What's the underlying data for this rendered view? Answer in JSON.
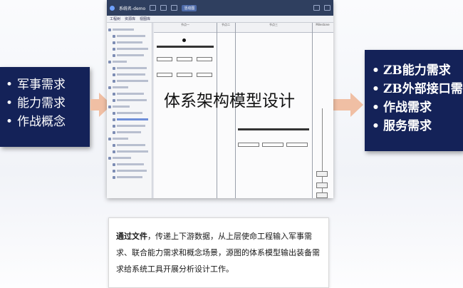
{
  "left_box": {
    "items": [
      "军事需求",
      "能力需求",
      "作战概念"
    ]
  },
  "right_box": {
    "items": [
      "ZB能力需求",
      "ZB外部接口需求",
      "作战需求",
      "服务需求"
    ]
  },
  "tool_window": {
    "title": "系统名-demo",
    "menus": [
      "工程树",
      "资源库",
      "视图库"
    ],
    "toolbar_chip": "活动图",
    "lanes": [
      "节点一",
      "节点二",
      "节点三",
      "Milestone"
    ]
  },
  "overlay_title": "体系架构模型设计",
  "caption": {
    "bold": "通过文件",
    "rest": "，传递上下游数据，从上层使命工程输入军事需求、联合能力需求和概念场景，源图的体系模型输出装备需求给系统工具开展分析设计工作。"
  },
  "colors": {
    "box_bg": "#142258",
    "arrow": "#f0bfa4"
  }
}
